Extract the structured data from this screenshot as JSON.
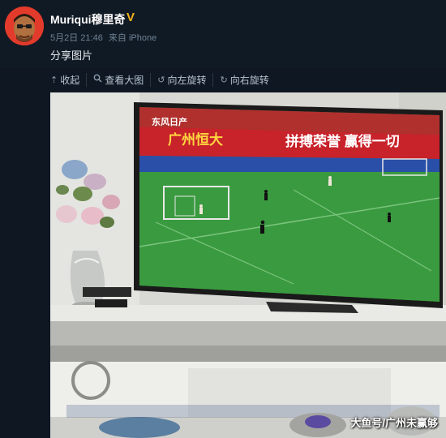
{
  "post": {
    "username": "Muriqui穆里奇",
    "verify_badge": "V",
    "date": "5月2日 21:46",
    "source": "来自 iPhone",
    "text": "分享图片"
  },
  "toolbar": {
    "collapse": "收起",
    "view_large": "查看大图",
    "rotate_left": "向左旋转",
    "rotate_right": "向右旋转"
  },
  "photo": {
    "tv_banner_1": "广州恒大",
    "tv_banner_2": "拼搏荣誉 赢得一切",
    "tv_banner_3": "东风日产",
    "watermark": "大鱼号/广州未赢够"
  }
}
